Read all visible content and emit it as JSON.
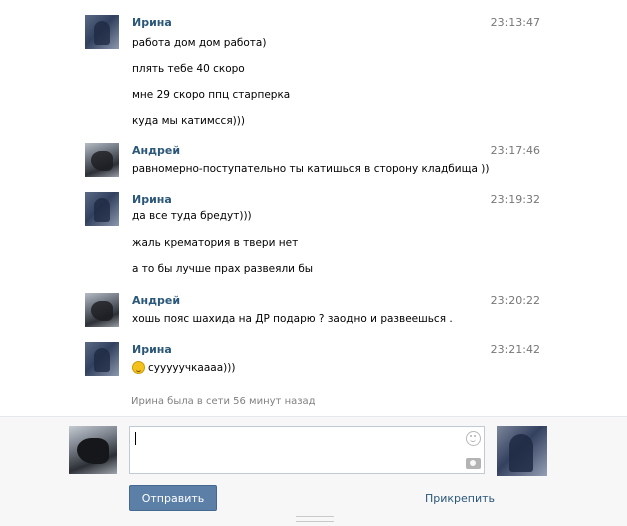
{
  "messages": [
    {
      "author": "Ирина",
      "time": "23:13:47",
      "lines": [
        "работа дом дом работа)",
        "плять тебе 40 скоро",
        "мне 29 скоро ппц старперка",
        "куда мы катимсся)))"
      ]
    },
    {
      "author": "Андрей",
      "time": "23:17:46",
      "lines": [
        "равномерно-поступательно ты катишься в сторону кладбища ))"
      ]
    },
    {
      "author": "Ирина",
      "time": "23:19:32",
      "lines": [
        "да все туда бредут)))",
        "жаль крематория в твери нет",
        "а то бы лучше прах развеяли бы"
      ]
    },
    {
      "author": "Андрей",
      "time": "23:20:22",
      "lines": [
        "хошь пояс шахида на ДР подарю ? заодно и развеешься ."
      ]
    },
    {
      "author": "Ирина",
      "time": "23:21:42",
      "lines": [
        "сууууучкаааа)))"
      ]
    }
  ],
  "status": "Ирина была в сети 56 минут назад",
  "compose": {
    "input_value": "",
    "send_label": "Отправить",
    "attach_label": "Прикрепить"
  },
  "icons": {
    "emoji": "smile-icon",
    "camera": "camera-icon",
    "message_smile": "laughing-emoji-icon"
  },
  "colors": {
    "author_link": "#2b587a",
    "send_button": "#5b7fa6",
    "timestamp": "#777777",
    "status": "#808080"
  }
}
